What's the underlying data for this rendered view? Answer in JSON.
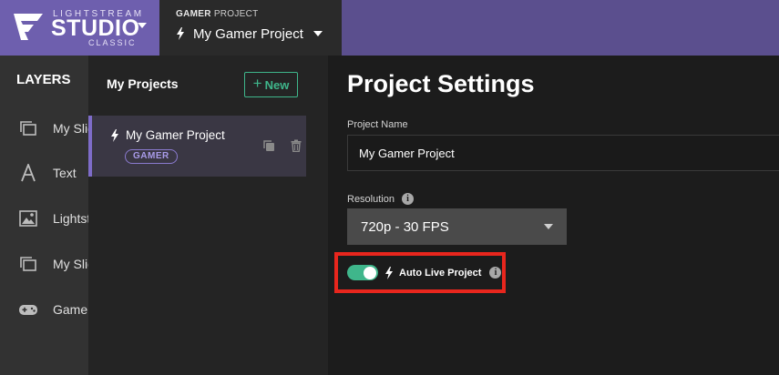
{
  "brand": {
    "top_text": "LIGHTSTREAM",
    "main_text": "STUDIO",
    "sub_text": "CLASSIC"
  },
  "header": {
    "project_label_bold": "GAMER",
    "project_label_rest": " PROJECT",
    "project_name": "My Gamer Project"
  },
  "layers": {
    "title": "LAYERS",
    "items": [
      {
        "label": "My Slideshow",
        "icon": "slideshow-icon"
      },
      {
        "label": "Text",
        "icon": "text-icon"
      },
      {
        "label": "Lightstream",
        "icon": "image-icon"
      },
      {
        "label": "My Slideshow",
        "icon": "slideshow-icon"
      },
      {
        "label": "Game Source",
        "icon": "gamepad-icon"
      }
    ]
  },
  "projects": {
    "title": "My Projects",
    "new_label": "New",
    "new_symbol": "+",
    "items": [
      {
        "name": "My Gamer Project",
        "tag": "GAMER",
        "selected": true
      }
    ]
  },
  "settings": {
    "title": "Project Settings",
    "name_label": "Project Name",
    "name_value": "My Gamer Project",
    "resolution_label": "Resolution",
    "resolution_value": "720p - 30 FPS",
    "auto_live_label": "Auto Live Project",
    "auto_live_enabled": true,
    "info_glyph": "i"
  },
  "colors": {
    "brand_purple": "#6e5fae",
    "accent_green": "#3fb68b",
    "highlight_red": "#e8261d",
    "tag_purple": "#8b7bd0"
  }
}
